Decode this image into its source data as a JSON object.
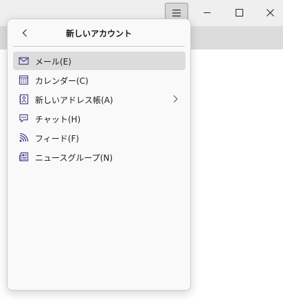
{
  "window": {
    "menu_button_icon": "hamburger-icon",
    "controls": {
      "minimize_icon": "minimize-icon",
      "maximize_icon": "maximize-icon",
      "close_icon": "close-icon"
    }
  },
  "menu": {
    "title": "新しいアカウント",
    "back_icon": "chevron-left-icon",
    "items": [
      {
        "label": "メール(E)",
        "icon": "mail-icon",
        "selected": true,
        "has_submenu": false
      },
      {
        "label": "カレンダー(C)",
        "icon": "calendar-icon",
        "selected": false,
        "has_submenu": false
      },
      {
        "label": "新しいアドレス帳(A)",
        "icon": "address-book-icon",
        "selected": false,
        "has_submenu": true
      },
      {
        "label": "チャット(H)",
        "icon": "chat-icon",
        "selected": false,
        "has_submenu": false
      },
      {
        "label": "フィード(F)",
        "icon": "feed-icon",
        "selected": false,
        "has_submenu": false
      },
      {
        "label": "ニュースグループ(N)",
        "icon": "newsgroup-icon",
        "selected": false,
        "has_submenu": false
      }
    ]
  },
  "colors": {
    "panel_bg": "#f9f9f9",
    "selected_bg": "#dcdcdc",
    "titlebar_bg": "#efefef",
    "icon_purple": "#4b3f8f"
  }
}
